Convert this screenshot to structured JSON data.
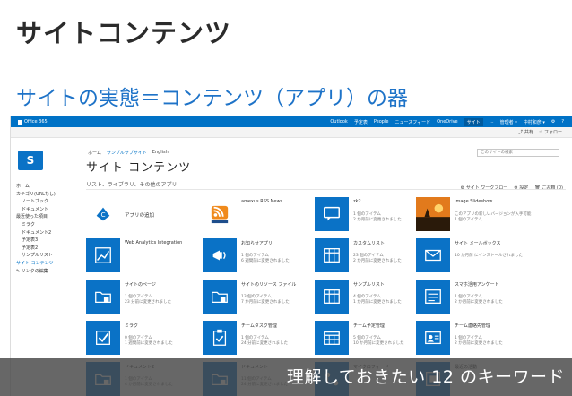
{
  "slide": {
    "title": "サイトコンテンツ",
    "subtitle": "サイトの実態＝コンテンツ（アプリ）の器",
    "footer": "理解しておきたい 12 のキーワード"
  },
  "suitebar": {
    "brand": "Office 365",
    "links": [
      "Outlook",
      "予定表",
      "People",
      "ニュースフィード",
      "OneDrive",
      "サイト",
      "…",
      "管理者 ▾",
      "中村和彦 ▾",
      "⚙",
      "?"
    ],
    "highlight_index": 5,
    "accent_color": "#0072c6"
  },
  "ribbon": {
    "share": "共有",
    "follow": "フォロー"
  },
  "logo": {
    "letter": "S"
  },
  "leftnav": [
    {
      "label": "ホーム",
      "indent": false
    },
    {
      "label": "カテゴリ(URLなし)",
      "indent": false
    },
    {
      "label": "ノートブック",
      "indent": true
    },
    {
      "label": "ドキュメント",
      "indent": true
    },
    {
      "label": "最近使った項目",
      "indent": false
    },
    {
      "label": "ミラク",
      "indent": true
    },
    {
      "label": "ドキュメント2",
      "indent": true
    },
    {
      "label": "予定表3",
      "indent": true
    },
    {
      "label": "予定表2",
      "indent": true
    },
    {
      "label": "サンプルリスト",
      "indent": true
    },
    {
      "label": "サイト コンテンツ",
      "indent": false,
      "selected": true
    },
    {
      "label": "✎ リンクの編集",
      "indent": false
    }
  ],
  "breadcrumb": {
    "home": "ホーム",
    "site": "サンプルサブサイト",
    "lang": "English"
  },
  "page_title": "サイト コンテンツ",
  "search": {
    "placeholder": "このサイトの検索"
  },
  "actions": {
    "workflow": "サイト ワークフロー",
    "settings": "設定",
    "recycle": "ごみ箱 (0)"
  },
  "section_heading": "リスト、ライブラリ、その他のアプリ",
  "tiles": [
    {
      "icon": "add-app-icon",
      "title": "アプリの追加",
      "meta1": "",
      "meta2": "",
      "plain": true
    },
    {
      "icon": "rss-icon",
      "title": "amexus RSS News",
      "meta1": "",
      "meta2": "",
      "plain": true
    },
    {
      "icon": "chat-icon",
      "title": "zk2",
      "meta1": "1 個のアイテム",
      "meta2": "2 か月前に変更されました"
    },
    {
      "icon": "photo-icon",
      "title": "Image Slideshow",
      "meta1": "このアプリの新しいバージョンが入手可能",
      "meta2": "1 個のアイテム",
      "photo": true
    },
    {
      "icon": "analytics-icon",
      "title": "Web Analytics Integration",
      "meta1": "",
      "meta2": ""
    },
    {
      "icon": "megaphone-icon",
      "title": "お知らせアプリ",
      "meta1": "1 個のアイテム",
      "meta2": "6 週間前に変更されました"
    },
    {
      "icon": "list-icon",
      "title": "カスタムリスト",
      "meta1": "23 個のアイテム",
      "meta2": "2 か月前に変更されました"
    },
    {
      "icon": "mail-icon",
      "title": "サイト メールボックス",
      "meta1": "10 か月前 にインストールされました",
      "meta2": ""
    },
    {
      "icon": "folder-icon",
      "title": "サイトのページ",
      "meta1": "1 個のアイテム",
      "meta2": "23 分前に変更されました"
    },
    {
      "icon": "folder-icon",
      "title": "サイトのリソース ファイル",
      "meta1": "13 個のアイテム",
      "meta2": "7 か月前に変更されました"
    },
    {
      "icon": "list-icon",
      "title": "サンプルリスト",
      "meta1": "4 個のアイテム",
      "meta2": "1 か月前に変更されました"
    },
    {
      "icon": "survey-icon",
      "title": "スマホ活用アンケート",
      "meta1": "1 個のアイテム",
      "meta2": "2 か月前に変更されました"
    },
    {
      "icon": "check-icon",
      "title": "ミラク",
      "meta1": "0 個のアイテム",
      "meta2": "1 週間前に変更されました"
    },
    {
      "icon": "task-icon",
      "title": "チームタスク管理",
      "meta1": "1 個のアイテム",
      "meta2": "24 分前に変更されました"
    },
    {
      "icon": "calendar-icon",
      "title": "チーム予定管理",
      "meta1": "5 個のアイテム",
      "meta2": "10 か月前に変更されました"
    },
    {
      "icon": "contact-icon",
      "title": "チーム連絡先管理",
      "meta1": "1 個のアイテム",
      "meta2": "2 か月前に変更されました"
    },
    {
      "icon": "folder-icon",
      "title": "ドキュメント2",
      "meta1": "1 個のアイテム",
      "meta2": "4 か月前に変更されました"
    },
    {
      "icon": "folder-icon",
      "title": "ドキュメント",
      "meta1": "11 個のアイテム",
      "meta2": "24 分前に変更されました"
    },
    {
      "icon": "workflow-icon",
      "title": "マイクロフィード",
      "meta1": "",
      "meta2": ""
    },
    {
      "icon": "archive-icon",
      "title": "最近の活動",
      "meta1": "",
      "meta2": ""
    }
  ]
}
